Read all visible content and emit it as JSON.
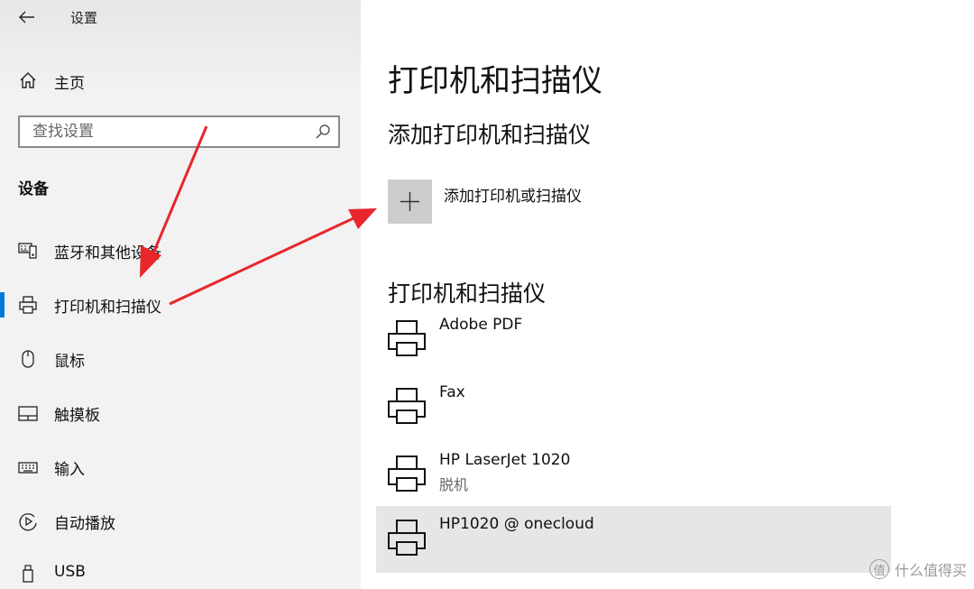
{
  "window": {
    "title": "设置"
  },
  "sidebar": {
    "home_label": "主页",
    "search_placeholder": "查找设置",
    "section_heading": "设备",
    "items": [
      {
        "label": "蓝牙和其他设备",
        "icon": "bluetooth-devices-icon",
        "active": false
      },
      {
        "label": "打印机和扫描仪",
        "icon": "printer-icon",
        "active": true
      },
      {
        "label": "鼠标",
        "icon": "mouse-icon",
        "active": false
      },
      {
        "label": "触摸板",
        "icon": "touchpad-icon",
        "active": false
      },
      {
        "label": "输入",
        "icon": "keyboard-icon",
        "active": false
      },
      {
        "label": "自动播放",
        "icon": "autoplay-icon",
        "active": false
      },
      {
        "label": "USB",
        "icon": "usb-icon",
        "active": false
      }
    ]
  },
  "main": {
    "title": "打印机和扫描仪",
    "add_section_heading": "添加打印机和扫描仪",
    "add_button_label": "添加打印机或扫描仪",
    "list_heading": "打印机和扫描仪",
    "printers": [
      {
        "name": "Adobe PDF",
        "status": "",
        "selected": false
      },
      {
        "name": "Fax",
        "status": "",
        "selected": false
      },
      {
        "name": "HP LaserJet 1020",
        "status": "脱机",
        "selected": false
      },
      {
        "name": "HP1020 @ onecloud",
        "status": "",
        "selected": true
      }
    ]
  },
  "colors": {
    "accent": "#0078d7",
    "annotation_arrow": "#e8262b",
    "sidebar_bg": "#f2f2f2",
    "selected_row_bg": "#e6e6e6",
    "add_tile_bg": "#cccccc"
  },
  "watermark": {
    "badge": "值",
    "text": "什么值得买"
  }
}
